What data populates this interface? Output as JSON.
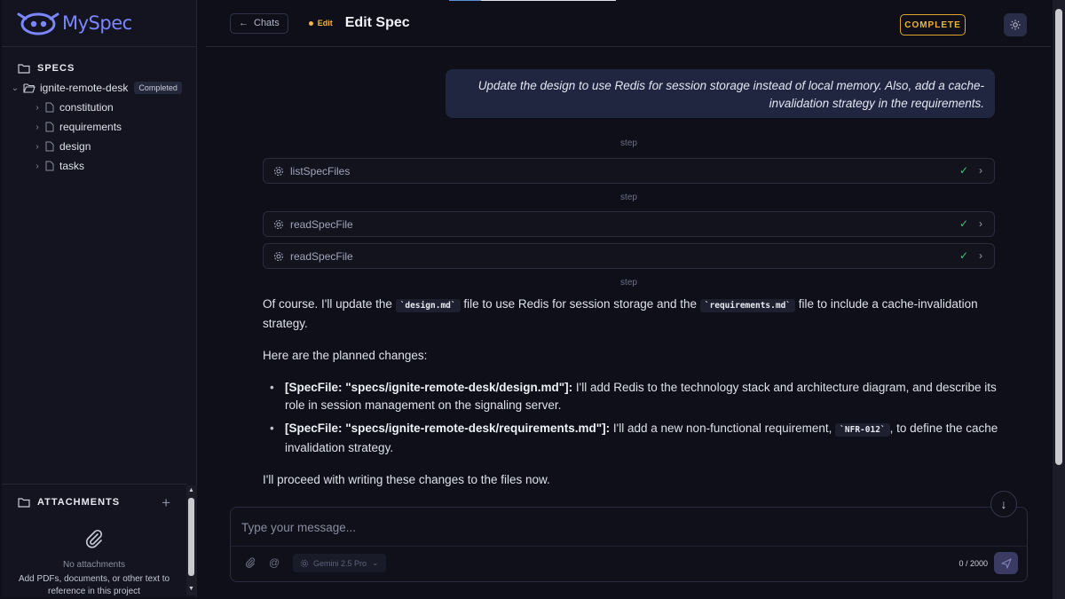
{
  "app": {
    "name": "MySpec"
  },
  "sidebar": {
    "specs_title": "SPECS",
    "project": {
      "name": "ignite-remote-desk",
      "status": "Completed"
    },
    "files": [
      {
        "label": "constitution"
      },
      {
        "label": "requirements"
      },
      {
        "label": "design"
      },
      {
        "label": "tasks"
      }
    ],
    "attachments": {
      "title": "ATTACHMENTS",
      "empty_title": "No attachments",
      "empty_desc": "Add PDFs, documents, or other text to reference in this project"
    }
  },
  "header": {
    "back_label": "Chats",
    "mode_label": "Edit",
    "title": "Edit Spec",
    "complete_label": "COMPLETE"
  },
  "chat": {
    "user_message": "Update the design to use Redis for session storage instead of local memory. Also, add a cache-invalidation strategy in the requirements.",
    "step_label": "step",
    "tool_calls": [
      {
        "name": "listSpecFiles"
      },
      {
        "name": "readSpecFile"
      },
      {
        "name": "readSpecFile"
      }
    ],
    "assistant": {
      "p1_a": "Of course. I'll update the",
      "p1_code1": "`design.md`",
      "p1_b": "file to use Redis for session storage and the",
      "p1_code2": "`requirements.md`",
      "p1_c": "file to include a cache-invalidation strategy.",
      "p2": "Here are the planned changes:",
      "bullet1_bold": "[SpecFile: \"specs/ignite-remote-desk/design.md\"]:",
      "bullet1_text": "I'll add Redis to the technology stack and architecture diagram, and describe its role in session management on the signaling server.",
      "bullet2_bold": "[SpecFile: \"specs/ignite-remote-desk/requirements.md\"]:",
      "bullet2_text_a": "I'll add a new non-functional requirement,",
      "bullet2_code": "`NFR-012`",
      "bullet2_text_b": ", to define the cache invalidation strategy.",
      "p3": "I'll proceed with writing these changes to the files now."
    }
  },
  "composer": {
    "placeholder": "Type your message...",
    "model": "Gemini 2.5 Pro",
    "counter": "0 / 2000"
  },
  "icons": [
    "logo-icon",
    "folder-icon",
    "folder-open-icon",
    "file-icon",
    "chevron-right-icon",
    "chevron-down-icon",
    "paperclip-icon",
    "plus-icon",
    "arrow-left-icon",
    "sun-icon",
    "gear-icon",
    "check-icon",
    "at-icon",
    "send-icon",
    "arrow-down-icon"
  ],
  "colors": {
    "accent": "#7b86ff",
    "warning": "#f0b23c",
    "success": "#3fc66f"
  }
}
